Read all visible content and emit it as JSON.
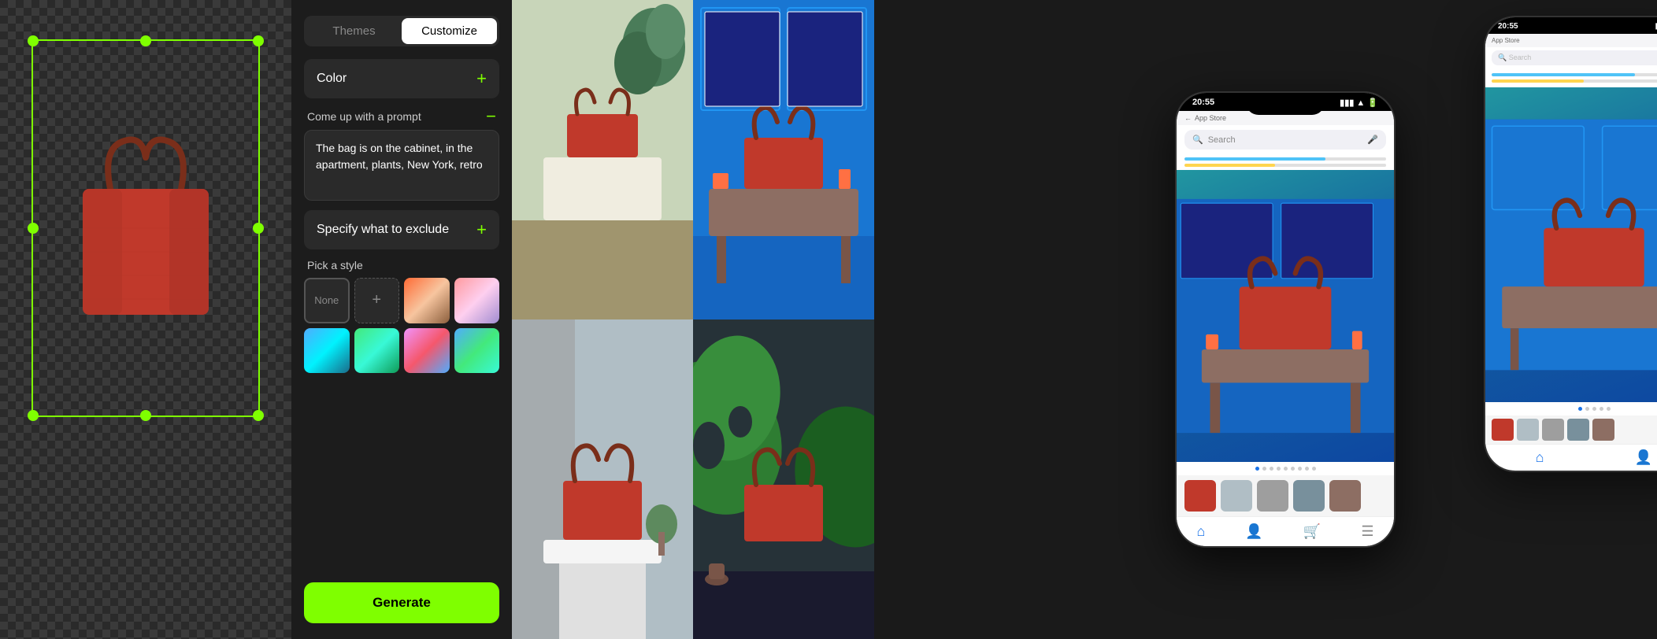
{
  "editor": {
    "background": "checker"
  },
  "controls": {
    "tabs": [
      {
        "label": "Themes",
        "active": false
      },
      {
        "label": "Customize",
        "active": true
      }
    ],
    "color_section": "Color",
    "prompt_section": "Come up with a prompt",
    "prompt_text": "The bag is on the cabinet, in the apartment, plants, New York, retro",
    "exclude_section": "Specify what to exclude",
    "style_section": "Pick a style",
    "styles": [
      {
        "label": "None",
        "type": "none"
      },
      {
        "label": "+",
        "type": "add"
      },
      {
        "label": "",
        "type": "swatch",
        "class": "swatch-1"
      },
      {
        "label": "",
        "type": "swatch",
        "class": "swatch-2"
      },
      {
        "label": "",
        "type": "swatch",
        "class": "swatch-3"
      },
      {
        "label": "",
        "type": "swatch",
        "class": "swatch-4"
      },
      {
        "label": "",
        "type": "swatch",
        "class": "swatch-5"
      },
      {
        "label": "",
        "type": "swatch",
        "class": "swatch-6"
      }
    ],
    "generate_btn": "Generate"
  },
  "phone_back": {
    "time": "20:55",
    "appstore": "App Store",
    "search_placeholder": "Search"
  },
  "phone_front": {
    "time": "20:55",
    "appstore": "App Store",
    "search_placeholder": "Search"
  }
}
